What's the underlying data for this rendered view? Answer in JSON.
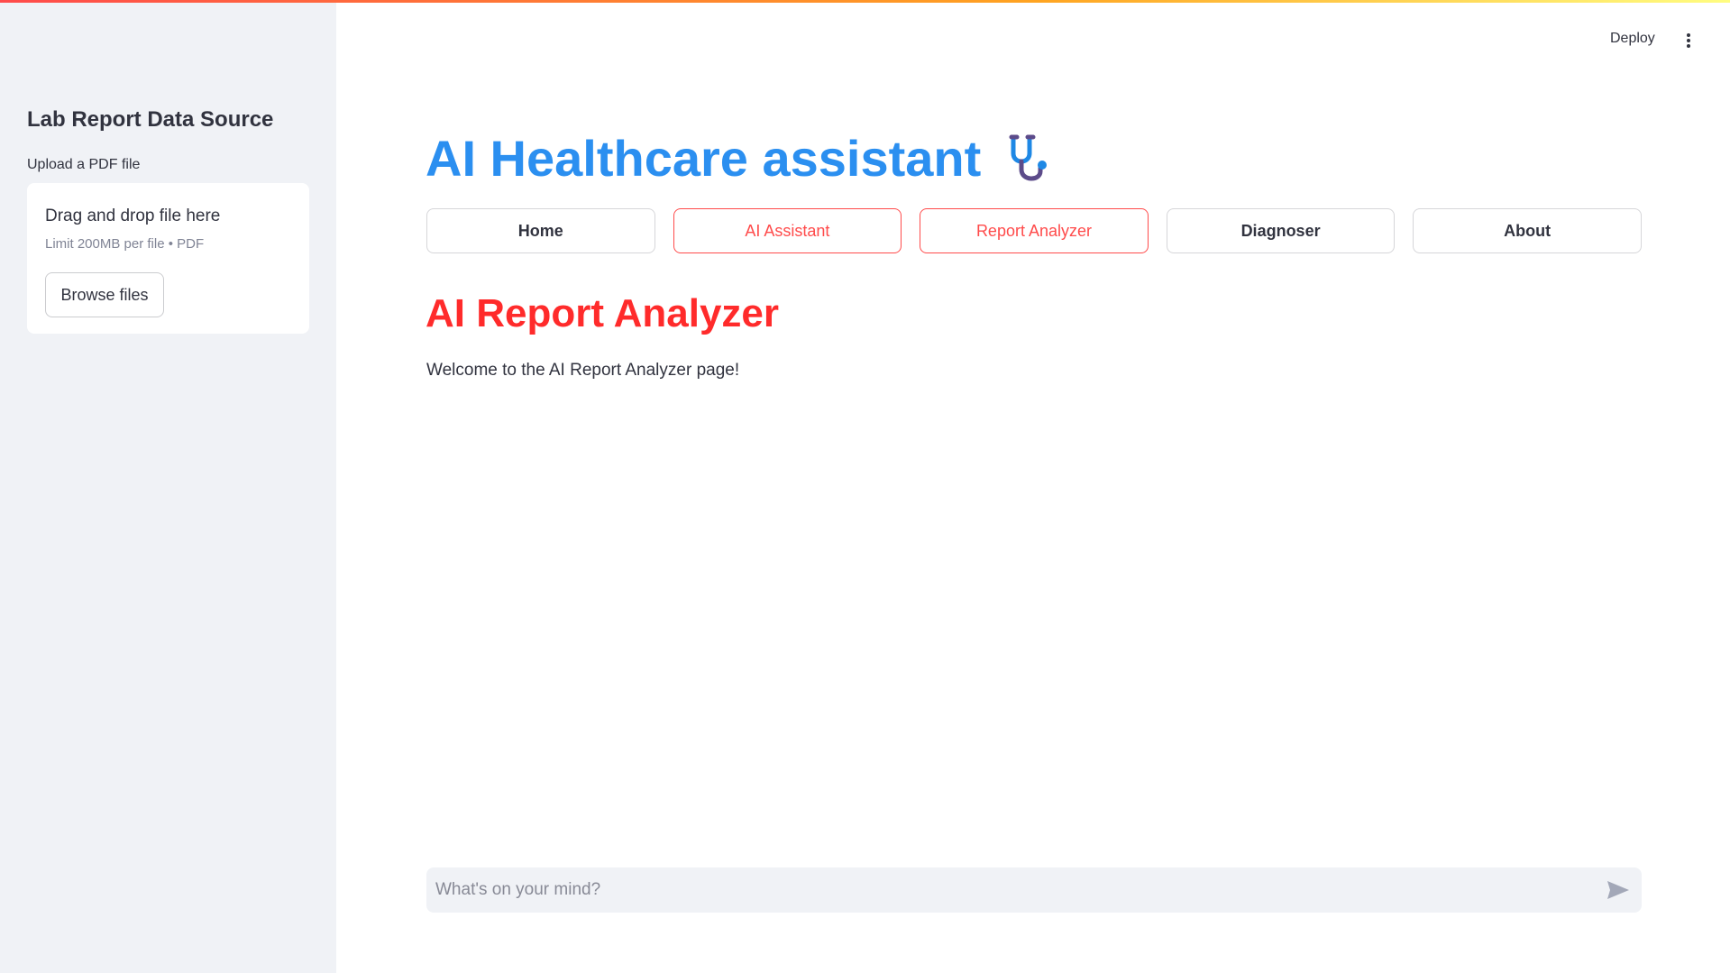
{
  "sidebar": {
    "title": "Lab Report Data Source",
    "upload_label": "Upload a PDF file",
    "dropzone": {
      "title": "Drag and drop file here",
      "hint": "Limit 200MB per file • PDF",
      "browse_label": "Browse files"
    }
  },
  "header": {
    "deploy_label": "Deploy",
    "menu_icon": "kebab-menu-icon"
  },
  "main": {
    "app_title": "AI Healthcare assistant",
    "title_icon": "stethoscope-icon",
    "nav": [
      {
        "label": "Home",
        "active": false
      },
      {
        "label": "AI Assistant",
        "active": true
      },
      {
        "label": "Report Analyzer",
        "active": true
      },
      {
        "label": "Diagnoser",
        "active": false
      },
      {
        "label": "About",
        "active": false
      }
    ],
    "page_title": "AI Report Analyzer",
    "welcome_text": "Welcome to the AI Report Analyzer page!"
  },
  "chat": {
    "placeholder": "What's on your mind?",
    "send_icon": "send-icon"
  },
  "colors": {
    "accent": "#ff4b4b",
    "title_blue": "#2b8ff0",
    "page_title_red": "#ff2b2b",
    "sidebar_bg": "#f0f2f6"
  }
}
